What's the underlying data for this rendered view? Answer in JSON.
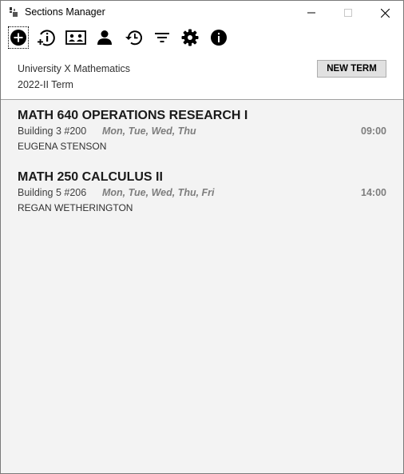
{
  "window": {
    "title": "Sections Manager",
    "icon": "app-logo-icon",
    "controls": [
      "minimize-icon",
      "maximize-icon",
      "close-icon"
    ]
  },
  "toolbar": {
    "icons": [
      "add-circle-icon",
      "info-add-icon",
      "id-card-icon",
      "person-icon",
      "history-icon",
      "filter-icon",
      "gear-icon",
      "info-icon"
    ]
  },
  "header": {
    "organization": "University X Mathematics",
    "term": "2022-II Term",
    "new_term_label": "NEW TERM"
  },
  "sections": [
    {
      "title": "MATH 640 OPERATIONS RESEARCH I",
      "room": "Building 3 #200",
      "days": "Mon, Tue, Wed, Thu",
      "time": "09:00",
      "instructor": "EUGENA STENSON"
    },
    {
      "title": "MATH 250 CALCULUS II",
      "room": "Building 5 #206",
      "days": "Mon, Tue, Wed, Thu, Fri",
      "time": "14:00",
      "instructor": "REGAN WETHERINGTON"
    }
  ],
  "colors": {
    "list_background": "#f3f3f3",
    "muted_text": "#7d7d7d",
    "button_face": "#e1e1e1"
  }
}
